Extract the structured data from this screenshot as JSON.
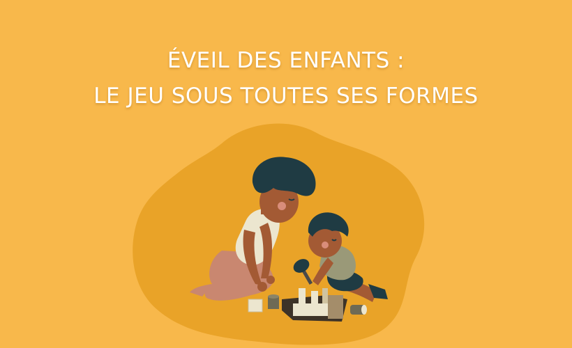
{
  "title": {
    "line1": "ÉVEIL DES ENFANTS :",
    "line2": "LE JEU SOUS TOUTES SES FORMES"
  },
  "colors": {
    "background": "#f8b84b",
    "blob": "#e9a328",
    "skin": "#a35a34",
    "hair": "#1f3b43",
    "mother_shirt": "#ece6cf",
    "mother_pants": "#c98770",
    "child_shirt": "#9a9978",
    "child_shorts": "#1f3b43",
    "title": "#ffffff"
  },
  "illustration": {
    "subject": "mother-and-child-playing-with-toy-blocks"
  }
}
